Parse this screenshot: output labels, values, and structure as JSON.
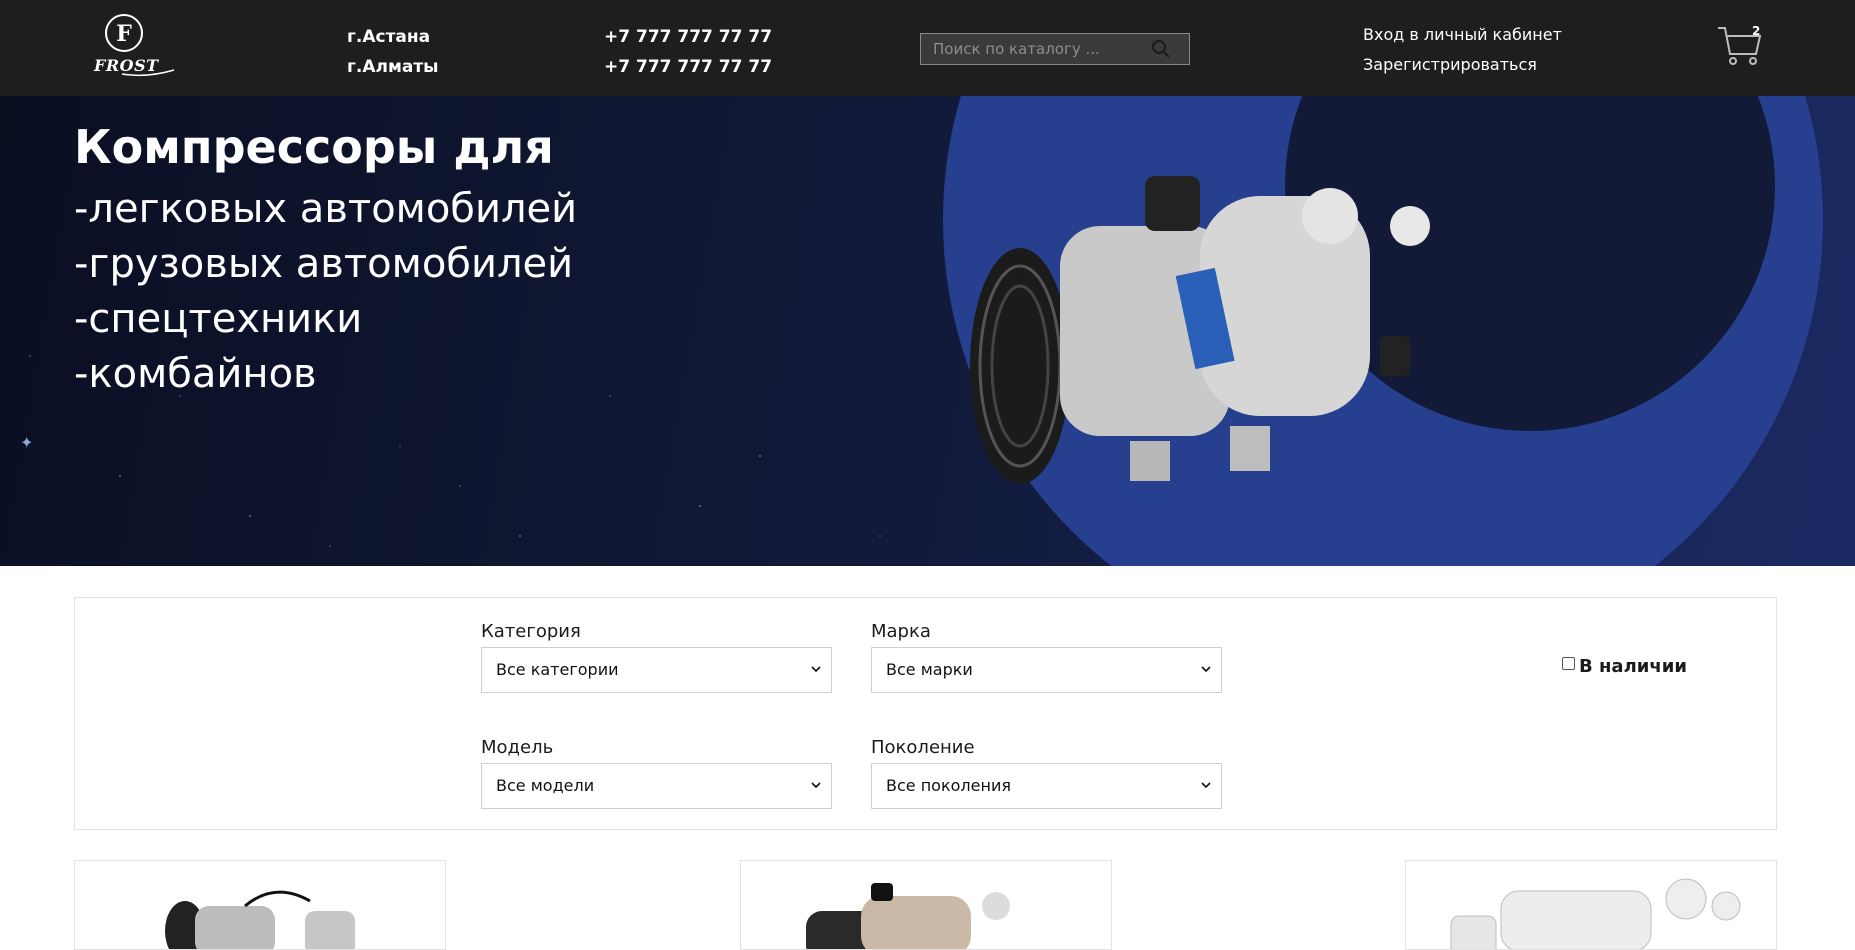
{
  "header": {
    "logo_text": "FROST",
    "cities": [
      "г.Астана",
      "г.Алматы"
    ],
    "phones": [
      "+7 777 777 77 77",
      "+7 777 777 77 77"
    ],
    "search_placeholder": "Поиск по каталогу ...",
    "login_label": "Вход в личный кабинет",
    "register_label": "Зарегистрироваться",
    "cart_count": "2"
  },
  "hero": {
    "title": "Компрессоры для",
    "lines": [
      "-легковых автомобилей",
      "-грузовых автомобилей",
      "-спецтехники",
      "-комбайнов"
    ]
  },
  "filters": {
    "category_label": "Категория",
    "category_value": "Все категории",
    "brand_label": "Марка",
    "brand_value": "Все марки",
    "model_label": "Модель",
    "model_value": "Все модели",
    "generation_label": "Поколение",
    "generation_value": "Все поколения",
    "in_stock_label": "В наличии"
  },
  "colors": {
    "header_bg": "#1e1e1e",
    "hero_circle": "#263f8f",
    "hero_dark_circle": "#111831"
  }
}
